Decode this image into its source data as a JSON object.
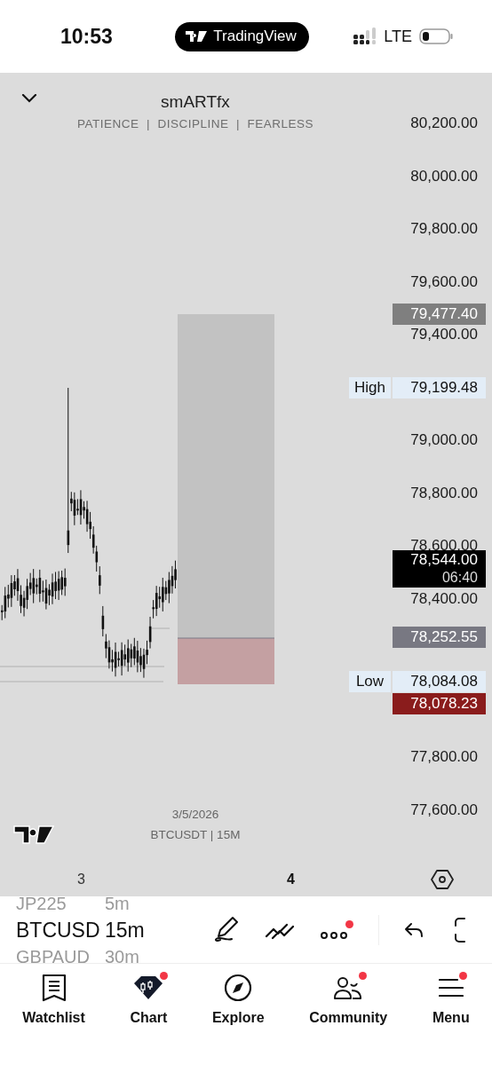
{
  "status_bar": {
    "time": "10:53",
    "app_pill": "TradingView",
    "network": "LTE"
  },
  "chart": {
    "title": "smARTfx",
    "subtitle": "PATIENCE  |  DISCIPLINE  |  FEARLESS",
    "price_ticks": [
      "80,200.00",
      "80,000.00",
      "79,800.00",
      "79,600.00",
      "79,400.00",
      "79,000.00",
      "78,800.00",
      "78,600.00",
      "78,400.00",
      "77,800.00",
      "77,600.00"
    ],
    "price_labels": [
      {
        "kind": "box",
        "value": "79,477.40",
        "color": "#7f7f7f"
      },
      {
        "kind": "tagged",
        "tag": "High",
        "value": "79,199.48"
      },
      {
        "kind": "countdown",
        "value": "78,544.00",
        "time": "06:40",
        "color": "#000000"
      },
      {
        "kind": "box",
        "value": "78,252.55",
        "color": "#787882"
      },
      {
        "kind": "tagged",
        "tag": "Low",
        "value": "78,084.08"
      },
      {
        "kind": "box",
        "value": "78,078.23",
        "color": "#8a1c1c"
      }
    ],
    "date": "3/5/2026",
    "symbol_line": "BTCUSDT | 15M",
    "time_axis": [
      {
        "label": "3",
        "emphasized": false
      },
      {
        "label": "4",
        "emphasized": true
      }
    ]
  },
  "toolbar": {
    "symbols": [
      {
        "label": "JP225",
        "selected": false
      },
      {
        "label": "BTCUSD",
        "selected": true
      },
      {
        "label": "GBPAUD",
        "selected": false
      }
    ],
    "intervals": [
      {
        "label": "5m",
        "selected": false
      },
      {
        "label": "15m",
        "selected": true
      },
      {
        "label": "30m",
        "selected": false
      }
    ],
    "tools": [
      {
        "kind": "pen",
        "badge": false
      },
      {
        "kind": "lines",
        "badge": false
      },
      {
        "kind": "more",
        "badge": true
      },
      {
        "kind": "undo",
        "badge": false
      },
      {
        "kind": "fullscreen",
        "badge": false
      }
    ]
  },
  "nav": [
    {
      "kind": "watchlist",
      "label": "Watchlist",
      "badge": false
    },
    {
      "kind": "chart",
      "label": "Chart",
      "badge": true
    },
    {
      "kind": "explore",
      "label": "Explore",
      "badge": false
    },
    {
      "kind": "community",
      "label": "Community",
      "badge": true
    },
    {
      "kind": "menu",
      "label": "Menu",
      "badge": true
    }
  ]
}
